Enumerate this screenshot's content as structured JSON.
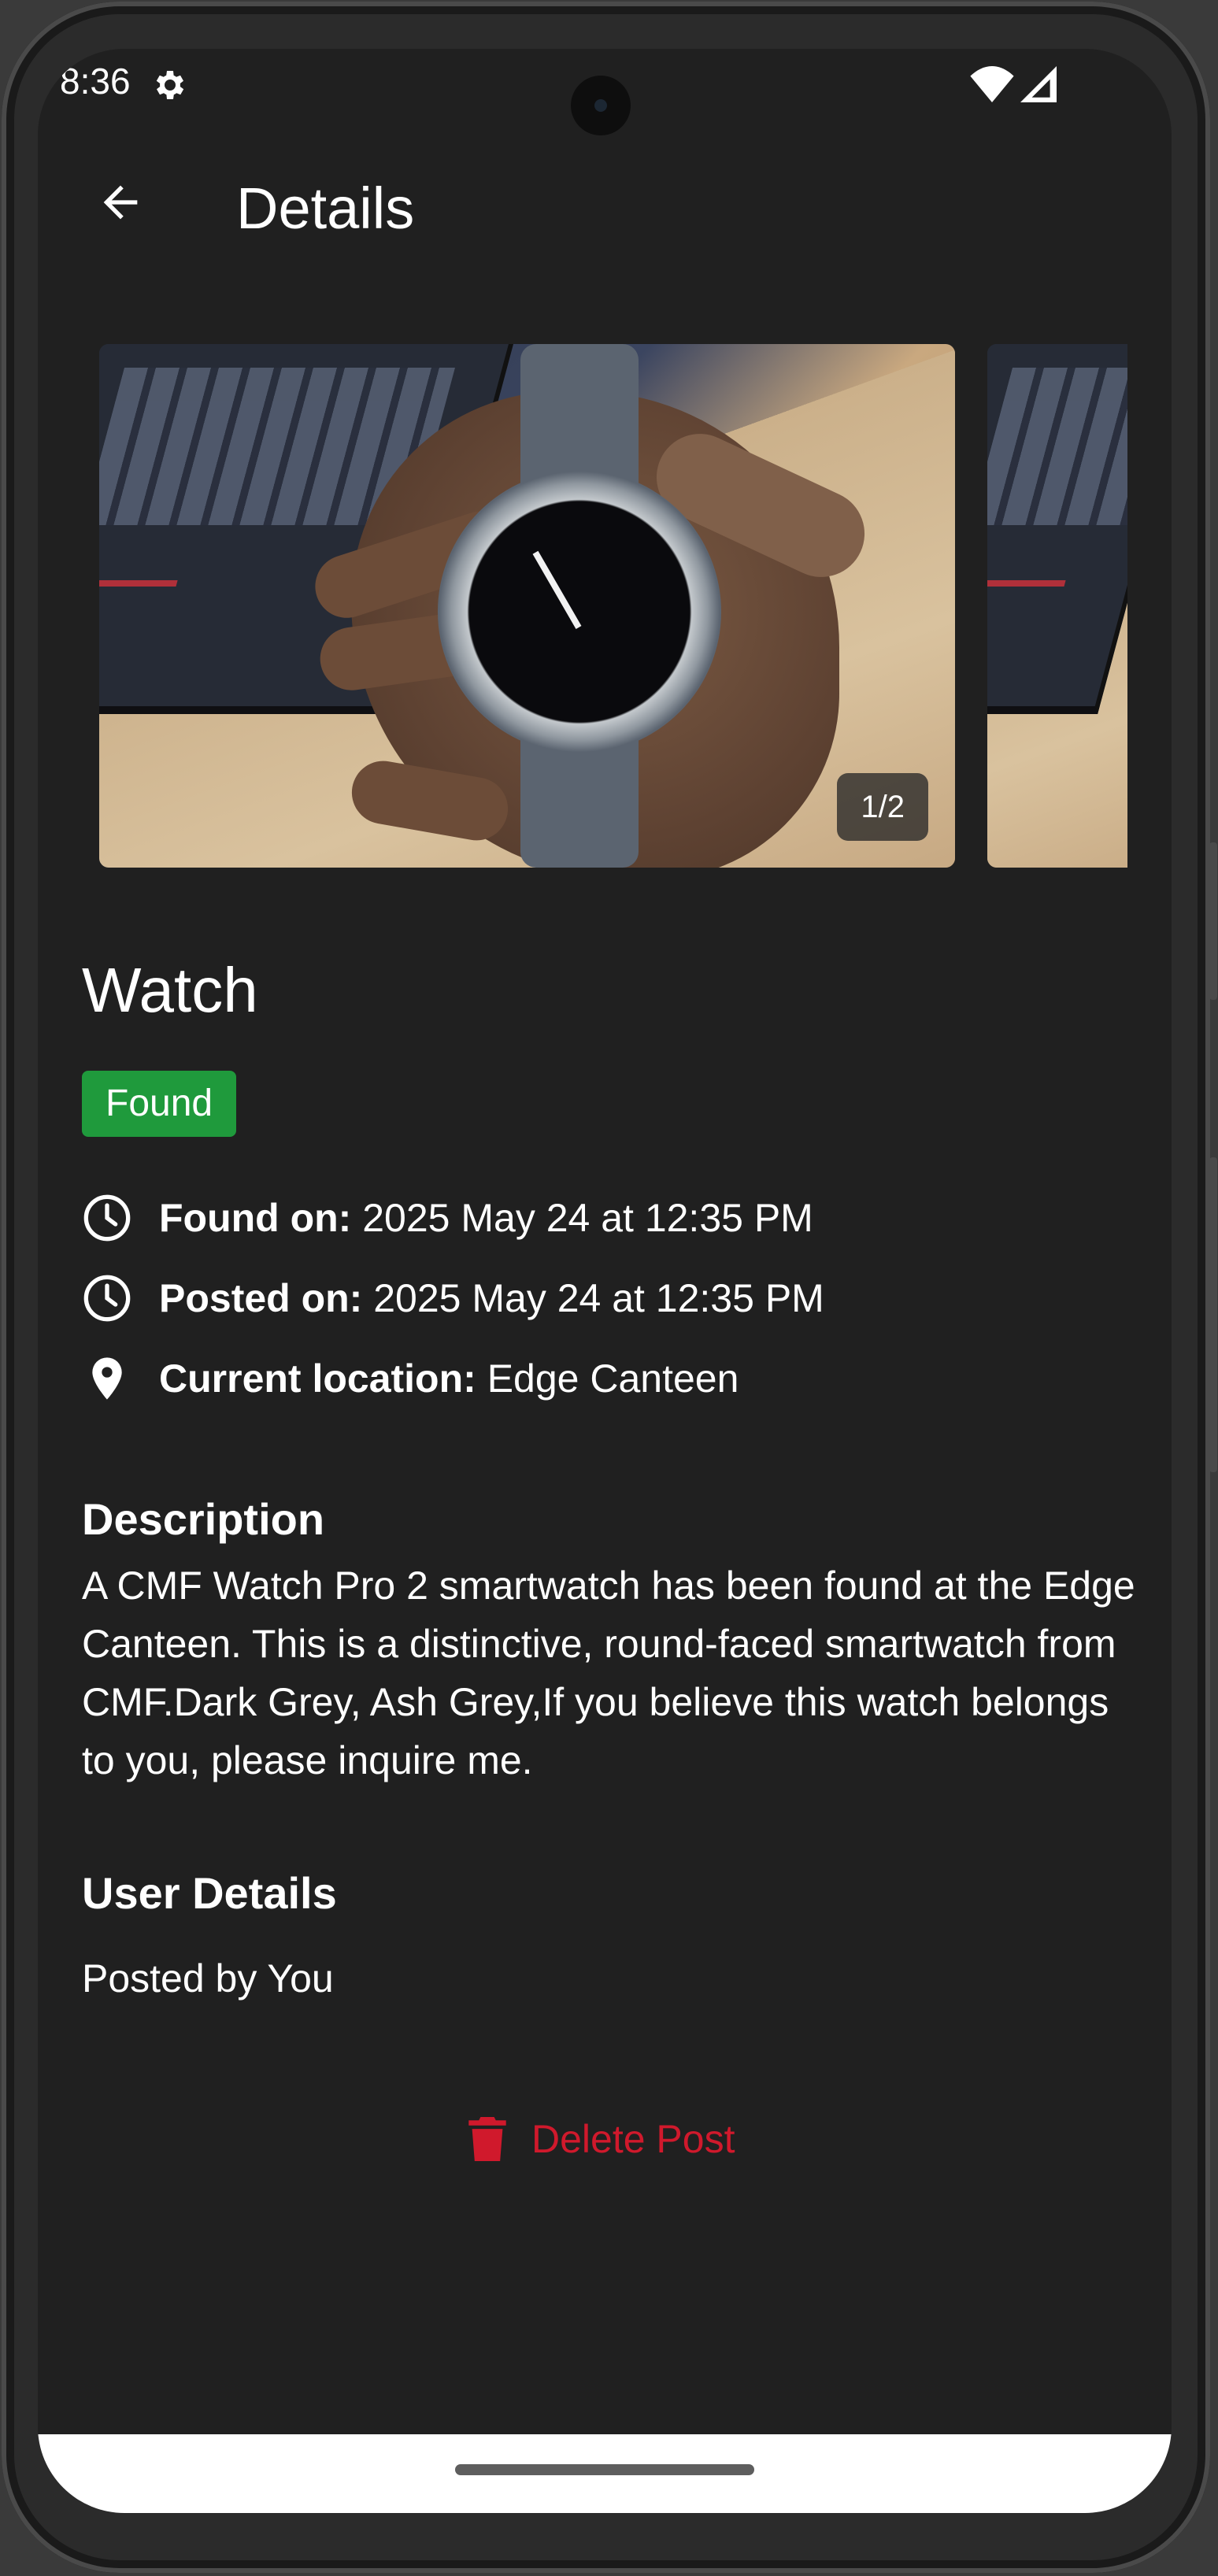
{
  "status_bar": {
    "time": "8:36",
    "icons": [
      "gear-icon",
      "wifi-icon",
      "signal-icon"
    ]
  },
  "app_bar": {
    "back_icon": "arrow-back-icon",
    "title": "Details"
  },
  "carousel": {
    "counter": "1/2",
    "images": [
      "watch-photo-1",
      "watch-photo-2"
    ]
  },
  "item": {
    "title": "Watch",
    "status": "Found",
    "status_color": "#1f9a3c",
    "found_on_label": "Found on:",
    "found_on_value": "2025 May 24 at 12:35 PM",
    "posted_on_label": "Posted on:",
    "posted_on_value": "2025 May 24 at 12:35 PM",
    "location_label": "Current location:",
    "location_value": "Edge Canteen"
  },
  "description": {
    "heading": "Description",
    "text": "A CMF Watch Pro 2 smartwatch has been found at the Edge Canteen. This is a distinctive, round-faced smartwatch from CMF.Dark Grey, Ash Grey,If you believe this watch belongs to you, please inquire me."
  },
  "user_details": {
    "heading": "User Details",
    "posted_by": "Posted by You"
  },
  "actions": {
    "delete_label": "Delete Post",
    "delete_icon": "trash-icon",
    "delete_color": "#d0192c"
  },
  "theme": {
    "background": "#202020",
    "text": "#ffffff"
  }
}
